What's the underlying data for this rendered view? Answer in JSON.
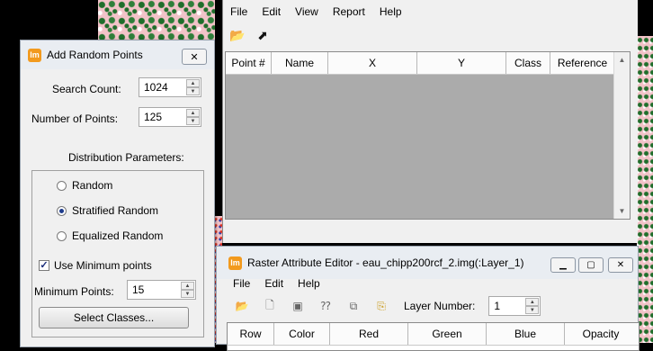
{
  "main_window": {
    "menu": [
      "File",
      "Edit",
      "View",
      "Report",
      "Help"
    ],
    "toolbar": [
      {
        "icon": "open-folder-icon",
        "glyph": "📂"
      },
      {
        "icon": "pin-cursor-icon",
        "glyph": "⬈"
      }
    ],
    "table": {
      "columns": [
        "Point #",
        "Name",
        "X",
        "Y",
        "Class",
        "Reference"
      ]
    }
  },
  "dialog": {
    "title": "Add Random Points",
    "app_icon_text": "lm",
    "close_glyph": "✕",
    "search_count_label": "Search Count:",
    "search_count_value": "1024",
    "num_points_label": "Number of Points:",
    "num_points_value": "125",
    "distribution_heading": "Distribution Parameters:",
    "options": [
      "Random",
      "Stratified Random",
      "Equalized Random"
    ],
    "selected_option": "Stratified Random",
    "use_min_label": "Use Minimum points",
    "use_min_checked": true,
    "min_points_label": "Minimum Points:",
    "min_points_value": "15",
    "select_classes_label": "Select Classes..."
  },
  "raster_editor": {
    "title": "Raster Attribute Editor - eau_chipp200rcf_2.img(:Layer_1)",
    "app_icon_text": "lm",
    "menu": [
      "File",
      "Edit",
      "Help"
    ],
    "layer_number_label": "Layer Number:",
    "layer_number_value": "1",
    "columns": [
      "Row",
      "Color",
      "Red",
      "Green",
      "Blue",
      "Opacity"
    ]
  }
}
